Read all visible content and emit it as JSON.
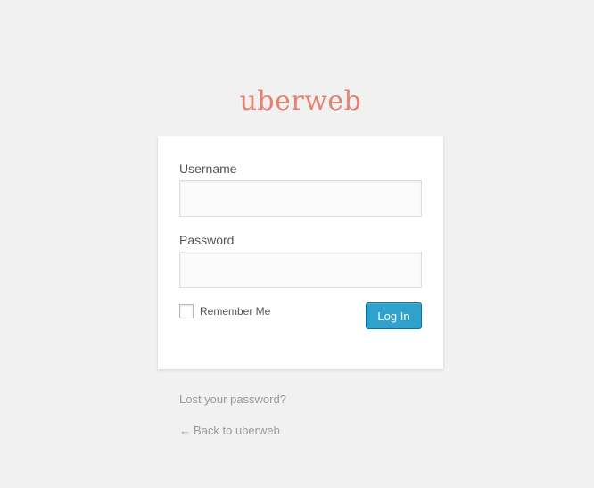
{
  "brand": {
    "logo_text": "uberweb",
    "accent_color": "#e6816f"
  },
  "login_form": {
    "username_label": "Username",
    "username_value": "",
    "password_label": "Password",
    "password_value": "",
    "remember_label": "Remember Me",
    "remember_checked": false,
    "submit_label": "Log In",
    "submit_color": "#2ea2cc"
  },
  "links": {
    "lost_password": "Lost your password?",
    "back_arrow": "←",
    "back_to_site": "Back to uberweb"
  }
}
